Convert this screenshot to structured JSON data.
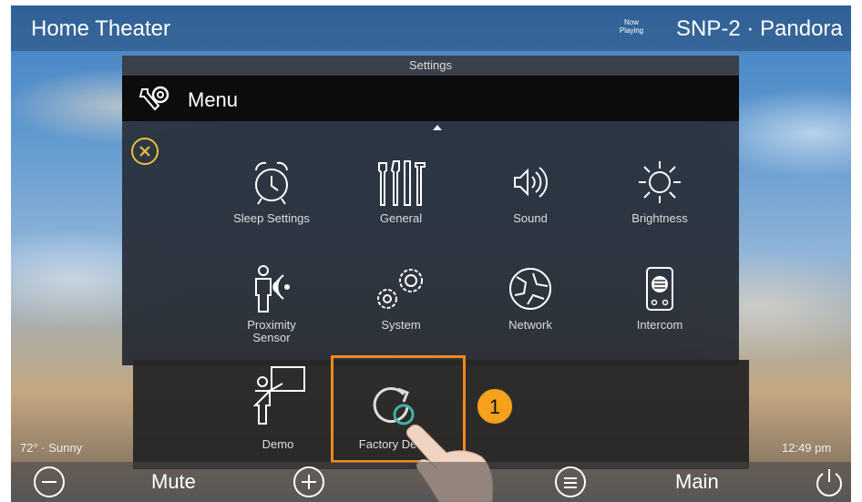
{
  "header": {
    "title": "Home Theater",
    "now_playing_tag": "Now Playing",
    "now_playing_source": "SNP-2 · Pandora"
  },
  "settings": {
    "header": "Settings",
    "menu_label": "Menu",
    "items": [
      {
        "label": "Sleep Settings",
        "icon": "alarm-clock-icon"
      },
      {
        "label": "General",
        "icon": "tools-icon"
      },
      {
        "label": "Sound",
        "icon": "speaker-icon"
      },
      {
        "label": "Brightness",
        "icon": "sun-icon"
      },
      {
        "label": "Proximity Sensor",
        "icon": "proximity-sensor-icon"
      },
      {
        "label": "System",
        "icon": "gears-icon"
      },
      {
        "label": "Network",
        "icon": "globe-icon"
      },
      {
        "label": "Intercom",
        "icon": "intercom-icon"
      },
      {
        "label": "Demo",
        "icon": "presenter-icon"
      },
      {
        "label": "Factory Defa",
        "icon": "factory-reset-icon"
      }
    ]
  },
  "annotation": {
    "step": "1"
  },
  "status": {
    "weather": "72° · Sunny",
    "time": "12:49 pm"
  },
  "bottom_bar": {
    "mute_label": "Mute",
    "main_label": "Main"
  },
  "colors": {
    "highlight": "#f18a1d",
    "badge": "#f6a11c",
    "close": "#e8c03a"
  }
}
